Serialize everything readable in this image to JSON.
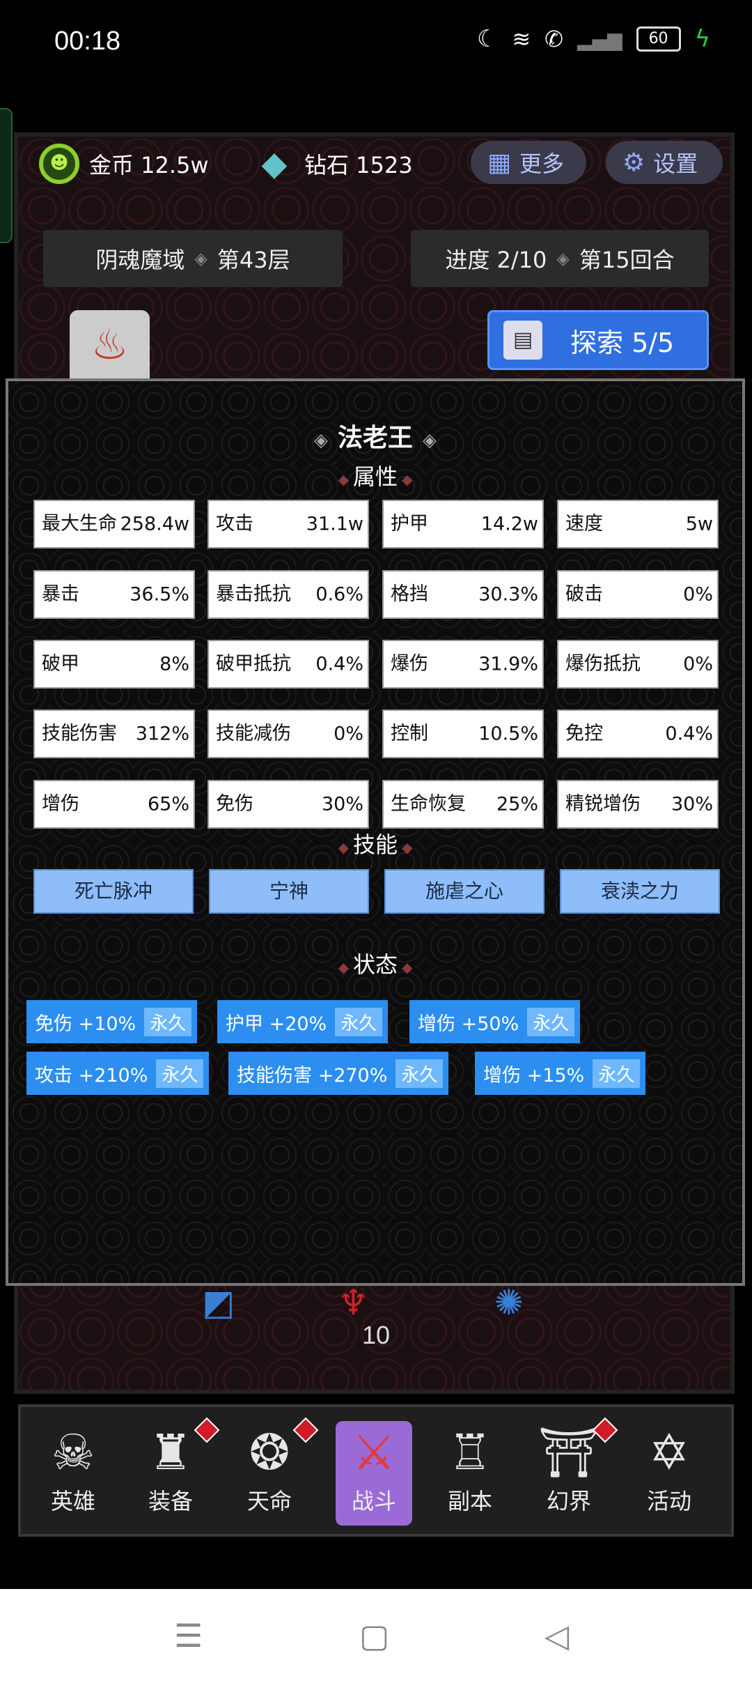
{
  "status_bar": {
    "time": "00:18",
    "battery": "60"
  },
  "resources": {
    "gold_label": "金币 12.5w",
    "diamond_label": "钻石 1523",
    "more_label": "更多",
    "settings_label": "设置"
  },
  "dungeon": {
    "name": "阴魂魔域",
    "floor": "第43层",
    "progress": "进度 2/10",
    "round": "第15回合"
  },
  "explore": {
    "label": "探索 5/5"
  },
  "panel": {
    "title": "法老王",
    "attr_section": "属性",
    "skills_section": "技能",
    "status_section": "状态",
    "attributes": [
      {
        "k": "最大生命",
        "v": "258.4w"
      },
      {
        "k": "攻击",
        "v": "31.1w"
      },
      {
        "k": "护甲",
        "v": "14.2w"
      },
      {
        "k": "速度",
        "v": "5w"
      },
      {
        "k": "暴击",
        "v": "36.5%"
      },
      {
        "k": "暴击抵抗",
        "v": "0.6%"
      },
      {
        "k": "格挡",
        "v": "30.3%"
      },
      {
        "k": "破击",
        "v": "0%"
      },
      {
        "k": "破甲",
        "v": "8%"
      },
      {
        "k": "破甲抵抗",
        "v": "0.4%"
      },
      {
        "k": "爆伤",
        "v": "31.9%"
      },
      {
        "k": "爆伤抵抗",
        "v": "0%"
      },
      {
        "k": "技能伤害",
        "v": "312%"
      },
      {
        "k": "技能减伤",
        "v": "0%"
      },
      {
        "k": "控制",
        "v": "10.5%"
      },
      {
        "k": "免控",
        "v": "0.4%"
      },
      {
        "k": "增伤",
        "v": "65%"
      },
      {
        "k": "免伤",
        "v": "30%"
      },
      {
        "k": "生命恢复",
        "v": "25%"
      },
      {
        "k": "精锐增伤",
        "v": "30%"
      }
    ],
    "skills": [
      "死亡脉冲",
      "宁神",
      "施虐之心",
      "衰渎之力"
    ],
    "buffs": [
      {
        "label": "免伤 +10%",
        "duration": "永久"
      },
      {
        "label": "护甲 +20%",
        "duration": "永久"
      },
      {
        "label": "增伤 +50%",
        "duration": "永久"
      },
      {
        "label": "攻击 +210%",
        "duration": "永久"
      },
      {
        "label": "技能伤害 +270%",
        "duration": "永久"
      },
      {
        "label": "增伤 +15%",
        "duration": "永久"
      }
    ]
  },
  "scene": {
    "counter": "10"
  },
  "nav": [
    "英雄",
    "装备",
    "天命",
    "战斗",
    "副本",
    "幻界",
    "活动"
  ]
}
